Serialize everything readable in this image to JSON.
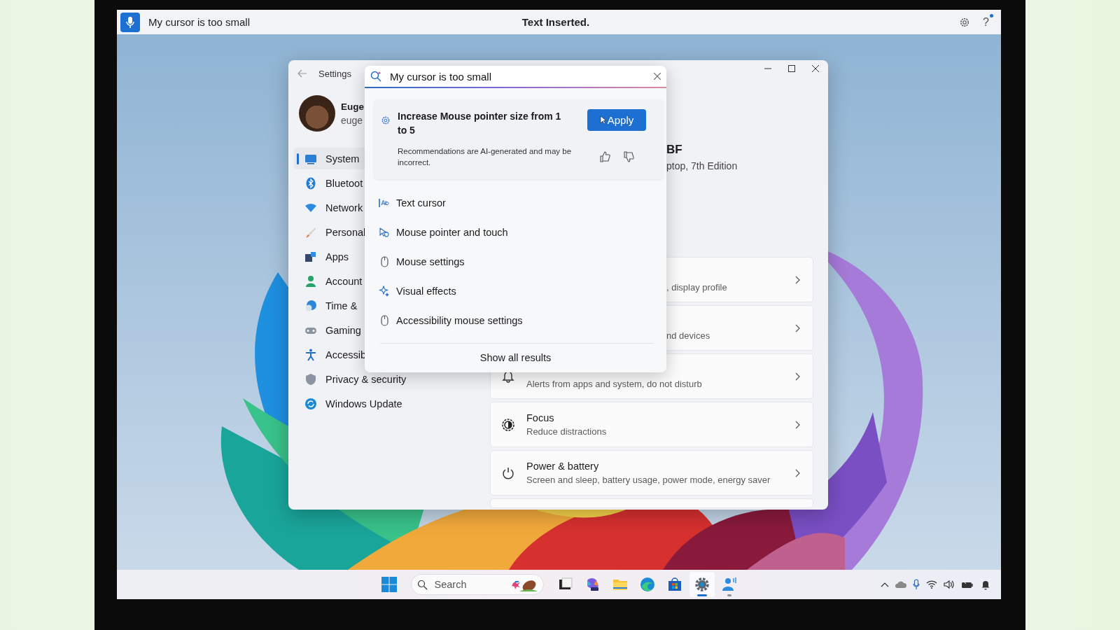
{
  "voice_access": {
    "transcript": "My cursor is too small",
    "status": "Text Inserted.",
    "help": "?"
  },
  "settings": {
    "title": "Settings",
    "user": {
      "name": "Euge",
      "email": "euge"
    },
    "nav": [
      {
        "label": "System",
        "selected": true
      },
      {
        "label": "Bluetoot",
        "selected": false
      },
      {
        "label": "Network",
        "selected": false
      },
      {
        "label": "Personal",
        "selected": false
      },
      {
        "label": "Apps",
        "selected": false
      },
      {
        "label": "Account",
        "selected": false
      },
      {
        "label": "Time &",
        "selected": false
      },
      {
        "label": "Gaming",
        "selected": false
      },
      {
        "label": "Accessib",
        "selected": false
      },
      {
        "label": "Privacy & security",
        "selected": false
      },
      {
        "label": "Windows Update",
        "selected": false
      }
    ],
    "device": {
      "name": "BF",
      "model": "ptop, 7th Edition"
    },
    "cards": [
      {
        "subtitle": ", display profile"
      },
      {
        "subtitle": "nd devices"
      },
      {
        "subtitle": "Alerts from apps and system, do not disturb"
      },
      {
        "title": "Focus",
        "subtitle": "Reduce distractions"
      },
      {
        "title": "Power & battery",
        "subtitle": "Screen and sleep, battery usage, power mode, energy saver"
      }
    ]
  },
  "search_flyout": {
    "query": "My cursor is too small",
    "suggestion": {
      "title": "Increase Mouse pointer size from 1 to 5",
      "button": "Apply",
      "disclaimer": "Recommendations are AI-generated and may be incorrect."
    },
    "results": [
      "Text cursor",
      "Mouse pointer and touch",
      "Mouse settings",
      "Visual effects",
      "Accessibility mouse settings"
    ],
    "show_all": "Show all results"
  },
  "taskbar": {
    "search_placeholder": "Search",
    "apps": [
      {
        "selected": false,
        "running": false
      },
      {
        "selected": false,
        "running": false
      },
      {
        "selected": false,
        "running": false
      },
      {
        "selected": false,
        "running": false
      },
      {
        "selected": false,
        "running": false
      },
      {
        "selected": true,
        "running": true
      },
      {
        "selected": false,
        "running": true
      }
    ]
  }
}
